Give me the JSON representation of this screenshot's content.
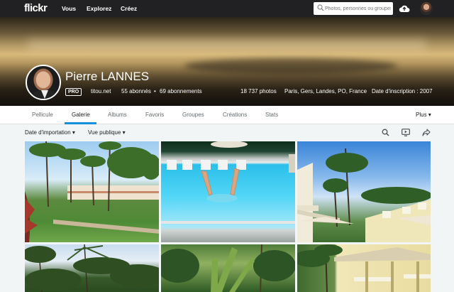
{
  "header": {
    "logo": "flickr",
    "nav": [
      "Vous",
      "Explorez",
      "Créez"
    ],
    "search_placeholder": "Photos, personnes ou groupes"
  },
  "profile": {
    "name": "Pierre LANNES",
    "badge": "PRO",
    "website": "titou.net",
    "followers": "55 abonnés",
    "separator": "•",
    "following": "69 abonnements",
    "photos": "18 737 photos",
    "location": "Paris, Gers, Landes, PO, France",
    "joined": "Date d'inscription : 2007"
  },
  "tabs": [
    {
      "label": "Pellicule"
    },
    {
      "label": "Galerie"
    },
    {
      "label": "Albums"
    },
    {
      "label": "Favoris"
    },
    {
      "label": "Groupes"
    },
    {
      "label": "Créations"
    },
    {
      "label": "Stats"
    }
  ],
  "active_tab": "Galerie",
  "more_label": "Plus",
  "toolbar": {
    "sort_label": "Date d'importation",
    "view_label": "Vue publique"
  },
  "photos": [
    {
      "icon": "photo-palm-garden"
    },
    {
      "icon": "photo-pool"
    },
    {
      "icon": "photo-resort-balcony"
    },
    {
      "icon": "photo-palms"
    },
    {
      "icon": "photo-garden-palm"
    },
    {
      "icon": "photo-resort-building"
    }
  ],
  "colors": {
    "topbar": "#212124",
    "accent": "#128fdc",
    "page_bg": "#f2f5f6"
  }
}
